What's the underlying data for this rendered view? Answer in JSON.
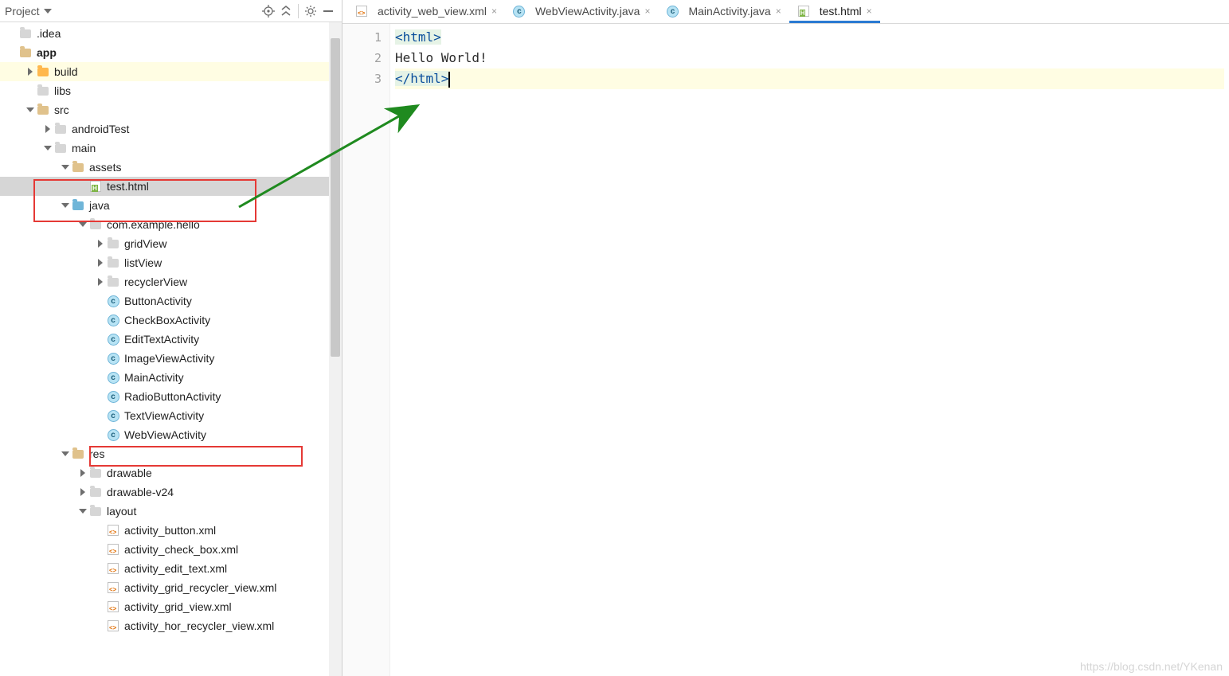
{
  "header": {
    "title": "Project",
    "icons": [
      "target-icon",
      "collapse-icon",
      "gear-icon",
      "minimize-icon"
    ]
  },
  "tree": [
    {
      "depth": 0,
      "arrow": "",
      "icon": "folder",
      "iconVariant": "",
      "label": ".idea"
    },
    {
      "depth": 0,
      "arrow": "",
      "icon": "folder",
      "iconVariant": "tan",
      "label": "app",
      "bold": true
    },
    {
      "depth": 1,
      "arrow": "right",
      "icon": "folder",
      "iconVariant": "orange",
      "label": "build",
      "rowStyle": "build"
    },
    {
      "depth": 1,
      "arrow": "",
      "icon": "folder",
      "iconVariant": "",
      "label": "libs"
    },
    {
      "depth": 1,
      "arrow": "down",
      "icon": "folder",
      "iconVariant": "tan",
      "label": "src"
    },
    {
      "depth": 2,
      "arrow": "right",
      "icon": "folder",
      "iconVariant": "",
      "label": "androidTest"
    },
    {
      "depth": 2,
      "arrow": "down",
      "icon": "folder",
      "iconVariant": "",
      "label": "main"
    },
    {
      "depth": 3,
      "arrow": "down",
      "icon": "folder",
      "iconVariant": "tan",
      "label": "assets"
    },
    {
      "depth": 4,
      "arrow": "",
      "icon": "html",
      "iconVariant": "",
      "label": "test.html",
      "rowStyle": "sel"
    },
    {
      "depth": 3,
      "arrow": "down",
      "icon": "folder",
      "iconVariant": "blue",
      "label": "java"
    },
    {
      "depth": 4,
      "arrow": "down",
      "icon": "folder",
      "iconVariant": "",
      "label": "com.example.hello"
    },
    {
      "depth": 5,
      "arrow": "right",
      "icon": "folder",
      "iconVariant": "",
      "label": "gridView"
    },
    {
      "depth": 5,
      "arrow": "right",
      "icon": "folder",
      "iconVariant": "",
      "label": "listView"
    },
    {
      "depth": 5,
      "arrow": "right",
      "icon": "folder",
      "iconVariant": "",
      "label": "recyclerView"
    },
    {
      "depth": 5,
      "arrow": "",
      "icon": "c",
      "iconVariant": "",
      "label": "ButtonActivity"
    },
    {
      "depth": 5,
      "arrow": "",
      "icon": "c",
      "iconVariant": "",
      "label": "CheckBoxActivity"
    },
    {
      "depth": 5,
      "arrow": "",
      "icon": "c",
      "iconVariant": "",
      "label": "EditTextActivity"
    },
    {
      "depth": 5,
      "arrow": "",
      "icon": "c",
      "iconVariant": "",
      "label": "ImageViewActivity"
    },
    {
      "depth": 5,
      "arrow": "",
      "icon": "c",
      "iconVariant": "",
      "label": "MainActivity"
    },
    {
      "depth": 5,
      "arrow": "",
      "icon": "c",
      "iconVariant": "",
      "label": "RadioButtonActivity"
    },
    {
      "depth": 5,
      "arrow": "",
      "icon": "c",
      "iconVariant": "",
      "label": "TextViewActivity"
    },
    {
      "depth": 5,
      "arrow": "",
      "icon": "c",
      "iconVariant": "",
      "label": "WebViewActivity"
    },
    {
      "depth": 3,
      "arrow": "down",
      "icon": "folder",
      "iconVariant": "tan",
      "label": "res"
    },
    {
      "depth": 4,
      "arrow": "right",
      "icon": "folder",
      "iconVariant": "",
      "label": "drawable"
    },
    {
      "depth": 4,
      "arrow": "right",
      "icon": "folder",
      "iconVariant": "",
      "label": "drawable-v24"
    },
    {
      "depth": 4,
      "arrow": "down",
      "icon": "folder",
      "iconVariant": "",
      "label": "layout"
    },
    {
      "depth": 5,
      "arrow": "",
      "icon": "xml",
      "iconVariant": "",
      "label": "activity_button.xml"
    },
    {
      "depth": 5,
      "arrow": "",
      "icon": "xml",
      "iconVariant": "",
      "label": "activity_check_box.xml"
    },
    {
      "depth": 5,
      "arrow": "",
      "icon": "xml",
      "iconVariant": "",
      "label": "activity_edit_text.xml"
    },
    {
      "depth": 5,
      "arrow": "",
      "icon": "xml",
      "iconVariant": "",
      "label": "activity_grid_recycler_view.xml"
    },
    {
      "depth": 5,
      "arrow": "",
      "icon": "xml",
      "iconVariant": "",
      "label": "activity_grid_view.xml"
    },
    {
      "depth": 5,
      "arrow": "",
      "icon": "xml",
      "iconVariant": "",
      "label": "activity_hor_recycler_view.xml"
    }
  ],
  "tabs": [
    {
      "icon": "xml",
      "label": "activity_web_view.xml",
      "active": false
    },
    {
      "icon": "c",
      "label": "WebViewActivity.java",
      "active": false
    },
    {
      "icon": "c",
      "label": "MainActivity.java",
      "active": false
    },
    {
      "icon": "html",
      "label": "test.html",
      "active": true
    }
  ],
  "editor": {
    "lines": [
      "1",
      "2",
      "3"
    ],
    "code": {
      "l1": {
        "open": "<",
        "name": "html",
        "close": ">"
      },
      "l2": "Hello World!",
      "l3": {
        "open": "</",
        "name": "html",
        "close": ">"
      }
    }
  },
  "watermark": "https://blog.csdn.net/YKenan"
}
